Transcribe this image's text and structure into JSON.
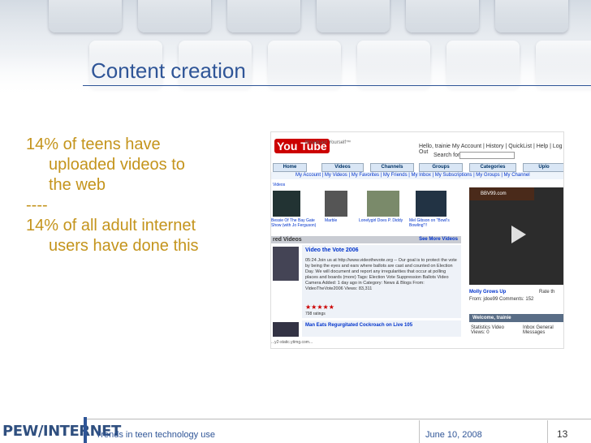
{
  "slide": {
    "title": "Content creation",
    "bullets": [
      {
        "first": "14% of teens have",
        "rest": [
          "uploaded videos to",
          "the web"
        ]
      },
      {
        "first": "----",
        "rest": []
      },
      {
        "first": "14% of all adult internet",
        "rest": [
          "users have done this"
        ]
      }
    ]
  },
  "screenshot": {
    "logo": "You Tube",
    "tagline": "Broadcast Yourself™",
    "hello": "Hello, trainie  My Account | History | QuickList | Help | Log Out",
    "search_label": "Search for",
    "tabs": [
      "Home",
      "Videos",
      "Channels",
      "Groups",
      "Categories",
      "Uplo"
    ],
    "subnav": "My Account | My Videos | My Favorites | My Friends | My Inbox | My Subscriptions | My Groups | My Channel",
    "videos_label": "Videos",
    "thumb_caps": [
      "Bessie Of The Bay\nGate Show (with\nJo Ferguson)",
      "Marble",
      "Lonelygirl Does P. Diddy",
      "Mel Gibson on \"Bowl's\nBowling\"!!"
    ],
    "featured_header": "red Videos",
    "see_more": "See More Videos",
    "feat_title": "Video the Vote 2006",
    "feat_text": "05:24  Join us at http://www.videothevote.org -- Our goal is to protect the vote by being the eyes and ears where ballots are cast and counted on Election Day. We will document and report any irregularities that occur at polling places and boards (more)  Tags: Election Vote Suppression Ballots Video Camera  Added: 1 day ago in Category: News & Blogs  From: VideoTheVote2006  Views: 83,311",
    "ratings": "798 ratings",
    "second_title": "Man Eats Regurgitated Cockroach on Live 105",
    "status_url": "...y2-static.ytimg.com...",
    "ad_text": "BBV99.com",
    "side_title": "Molly Grows Up",
    "side_meta": "From: jdoe99  Comments: 152",
    "rate_label": "Rate th",
    "welcome": "Welcome, trainie",
    "stats": "Statistics  Video Views: 0",
    "inbox": "Inbox  General Messages",
    "tab_colors": {
      "tab_bg": "#d9e6f5",
      "logo_red": "#cc0000"
    }
  },
  "footer": {
    "logo": "PEW/INTERNET",
    "title": "Trends in teen technology use",
    "date": "June 10, 2008",
    "page": "13"
  },
  "colors": {
    "title": "#2f5597",
    "bullets": "#c4941c"
  }
}
